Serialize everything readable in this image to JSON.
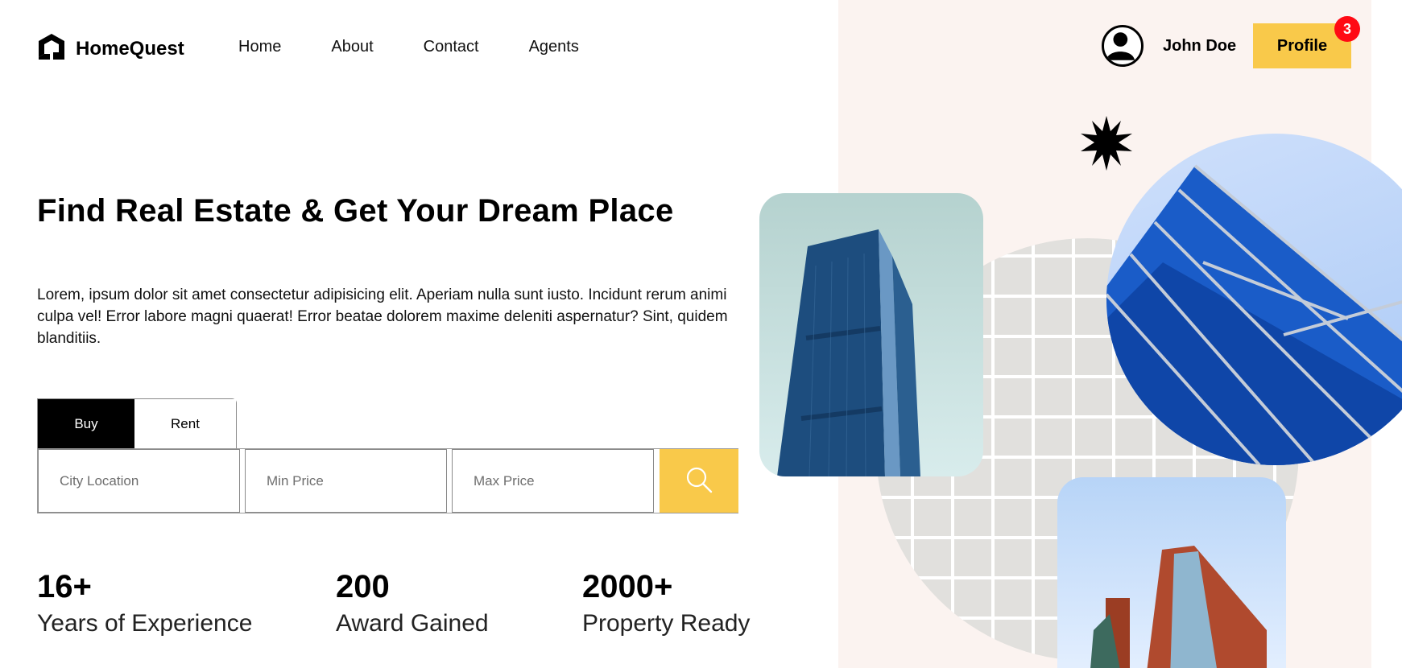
{
  "brand": {
    "name": "HomeQuest"
  },
  "nav": {
    "items": [
      {
        "label": "Home"
      },
      {
        "label": "About"
      },
      {
        "label": "Contact"
      },
      {
        "label": "Agents"
      }
    ]
  },
  "user": {
    "name": "John Doe",
    "profile_label": "Profile",
    "notification_count": "3"
  },
  "hero": {
    "title": "Find Real Estate & Get Your Dream Place",
    "description": "Lorem, ipsum dolor sit amet consectetur adipisicing elit. Aperiam nulla sunt iusto. Incidunt rerum animi culpa vel! Error labore magni quaerat! Error beatae dolorem maxime deleniti aspernatur? Sint, quidem blanditiis."
  },
  "search": {
    "tabs": [
      {
        "label": "Buy",
        "active": true
      },
      {
        "label": "Rent",
        "active": false
      }
    ],
    "fields": {
      "city": {
        "placeholder": "City Location",
        "value": ""
      },
      "min_price": {
        "placeholder": "Min Price",
        "value": ""
      },
      "max_price": {
        "placeholder": "Max Price",
        "value": ""
      }
    },
    "button_icon": "search-icon"
  },
  "stats": [
    {
      "value": "16+",
      "label": "Years of Experience"
    },
    {
      "value": "200",
      "label": "Award Gained"
    },
    {
      "value": "2000+",
      "label": "Property Ready"
    }
  ],
  "colors": {
    "accent": "#f9c94a",
    "badge": "#ff0a14",
    "panel": "#fbf3f0"
  }
}
